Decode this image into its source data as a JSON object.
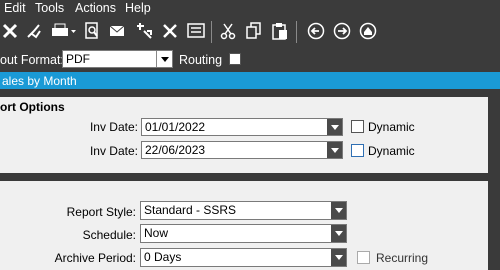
{
  "menu": {
    "edit": "Edit",
    "tools": "Tools",
    "actions": "Actions",
    "help": "Help"
  },
  "toolbar": {
    "icons": [
      "close-icon",
      "clear-icon",
      "print-icon",
      "preview-icon",
      "email-icon",
      "schedule-icon",
      "settings-icon",
      "layout-icon",
      "cut-icon",
      "copy-icon",
      "paste-icon",
      "back-icon",
      "forward-icon",
      "home-icon"
    ]
  },
  "format_row": {
    "label": "out Format:",
    "value": "PDF",
    "routing_label": "Routing"
  },
  "title": "ales by Month",
  "report_options": {
    "header": "ort Options",
    "inv_date_1": {
      "label": "Inv Date:",
      "value": "01/01/2022",
      "dynamic_label": "Dynamic"
    },
    "inv_date_2": {
      "label": "Inv Date:",
      "value": "22/06/2023",
      "dynamic_label": "Dynamic"
    }
  },
  "report_settings": {
    "style": {
      "label": "Report Style:",
      "value": "Standard - SSRS"
    },
    "schedule": {
      "label": "Schedule:",
      "value": "Now"
    },
    "archive": {
      "label": "Archive Period:",
      "value": "0 Days",
      "recurring_label": "Recurring"
    }
  },
  "colors": {
    "titlebar": "#1a9ad6",
    "chrome": "#3b3b3b",
    "panel": "#f0f0f0"
  }
}
